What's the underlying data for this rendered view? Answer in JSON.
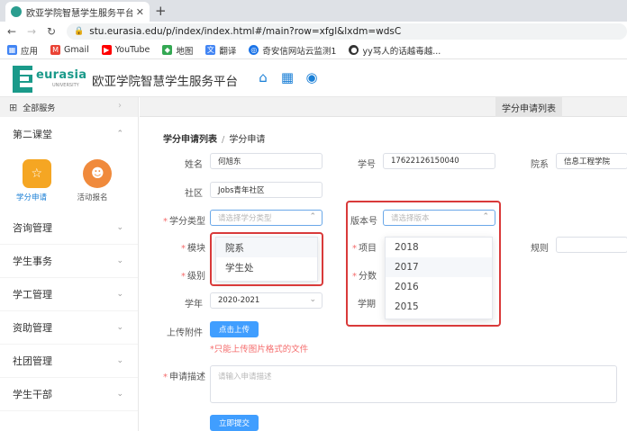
{
  "browser": {
    "tab_title": "欧亚学院智慧学生服务平台",
    "tab_close": "✕",
    "new_tab": "+",
    "url": "stu.eurasia.edu/p/index/index.html#/main?row=xfgl&lxdm=wdsC",
    "bookmarks": [
      {
        "label": "应用",
        "icon": "apps-icon",
        "color": "#4285f4"
      },
      {
        "label": "Gmail",
        "icon": "gmail-icon",
        "color": "#ea4335"
      },
      {
        "label": "YouTube",
        "icon": "youtube-icon",
        "color": "#ff0000"
      },
      {
        "label": "地图",
        "icon": "maps-icon",
        "color": "#34a853"
      },
      {
        "label": "翻译",
        "icon": "translate-icon",
        "color": "#4285f4"
      },
      {
        "label": "奇安信网站云监测1",
        "icon": "monitor-icon",
        "color": "#1a73e8"
      },
      {
        "label": "yy骂人的话越毒越...",
        "icon": "bookmark-icon",
        "color": "#333333"
      }
    ]
  },
  "app": {
    "logo_word": "eurasia",
    "logo_sub": "UNIVERSITY",
    "title": "欧亚学院智慧学生服务平台",
    "accent": "#1a7fd6"
  },
  "sidebar": {
    "all_services": "全部服务",
    "expanded_menu": "第二课堂",
    "sub_items": [
      {
        "label": "学分申请",
        "color": "#f5a623",
        "icon": "certificate-icon",
        "active": true
      },
      {
        "label": "活动报名",
        "color": "#f08a3c",
        "icon": "user-icon",
        "active": false
      }
    ],
    "menus": [
      "咨询管理",
      "学生事务",
      "学工管理",
      "资助管理",
      "社团管理",
      "学生干部"
    ]
  },
  "content": {
    "active_tab": "学分申请列表",
    "breadcrumb": {
      "root": "学分申请列表",
      "sep": "/",
      "current": "学分申请"
    },
    "form": {
      "name": {
        "label": "姓名",
        "value": "何旭东"
      },
      "student_id": {
        "label": "学号",
        "value": "17622126150040"
      },
      "department": {
        "label": "院系",
        "value": "信息工程学院"
      },
      "community": {
        "label": "社区",
        "value": "Jobs青年社区"
      },
      "credit_type": {
        "label": "学分类型",
        "placeholder": "请选择学分类型"
      },
      "version": {
        "label": "版本号",
        "placeholder": "请选择版本"
      },
      "module": {
        "label": "模块"
      },
      "project": {
        "label": "项目"
      },
      "rule": {
        "label": "规则"
      },
      "level": {
        "label": "级别"
      },
      "score": {
        "label": "分数"
      },
      "school_year": {
        "label": "学年",
        "value": "2020-2021"
      },
      "semester": {
        "label": "学期"
      },
      "upload": {
        "label": "上传附件",
        "button": "点击上传",
        "hint": "*只能上传图片格式的文件"
      },
      "description": {
        "label": "申请描述",
        "placeholder": "请输入申请描述"
      },
      "submit": "立即提交"
    },
    "credit_type_options": [
      "院系",
      "学生处"
    ],
    "version_options": [
      "2018",
      "2017",
      "2016",
      "2015"
    ]
  }
}
